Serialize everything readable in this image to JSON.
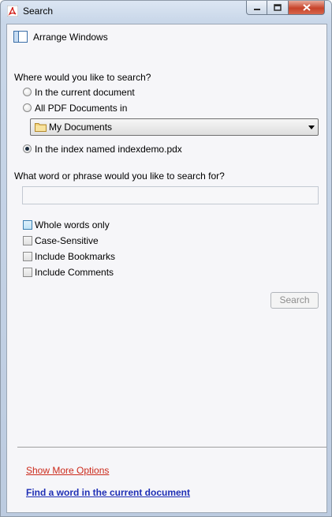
{
  "window": {
    "title": "Search",
    "icons": {
      "app": "adobe-pdf-icon",
      "minimize": "minimize-icon",
      "maximize": "maximize-icon",
      "close": "close-icon"
    }
  },
  "toolbar": {
    "arrange_label": "Arrange Windows",
    "arrange_icon": "arrange-windows-icon"
  },
  "search_location": {
    "question": "Where would you like to search?",
    "options": [
      {
        "label": "In the current document",
        "selected": false
      },
      {
        "label": "All PDF Documents in",
        "selected": false
      },
      {
        "label": "In the index named indexdemo.pdx",
        "selected": true
      }
    ],
    "folder_dropdown": {
      "selected": "My Documents",
      "icon": "folder-icon"
    }
  },
  "query": {
    "question": "What word or phrase would you like to search for?",
    "value": ""
  },
  "options": [
    {
      "label": "Whole words only",
      "checked": false
    },
    {
      "label": "Case-Sensitive",
      "checked": false
    },
    {
      "label": "Include Bookmarks",
      "checked": false
    },
    {
      "label": "Include Comments",
      "checked": false
    }
  ],
  "search_button": {
    "label": "Search",
    "enabled": false
  },
  "links": {
    "more_options": "Show More Options",
    "find_word": "Find a word in the current document"
  },
  "colors": {
    "link_red": "#cc2a1b",
    "link_blue": "#1f2fb5",
    "close_red": "#c7432a"
  }
}
